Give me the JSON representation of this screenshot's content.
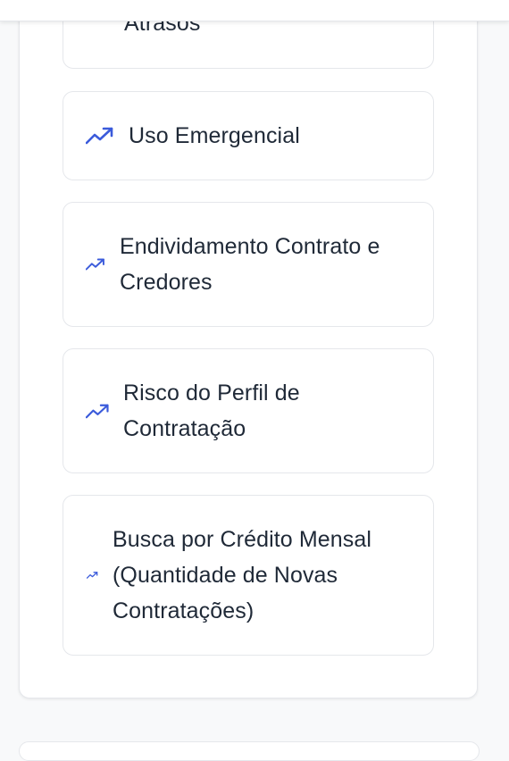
{
  "header": {},
  "indicator_list": {
    "items": [
      {
        "label": "Atrasos",
        "icon": "trending-up-icon"
      },
      {
        "label": "Uso Emergencial",
        "icon": "trending-up-icon"
      },
      {
        "label": "Endividamento Contrato e Credores",
        "icon": "trending-up-icon"
      },
      {
        "label": "Risco do Perfil de Contratação",
        "icon": "trending-up-icon"
      },
      {
        "label": "Busca por Crédito Mensal (Quantidade de Novas Contratações)",
        "icon": "trending-up-icon"
      }
    ]
  },
  "colors": {
    "icon_accent": "#3b5bdb",
    "text": "#1f2937",
    "border": "#e5e7eb",
    "background": "#f8f9fa",
    "card": "#ffffff"
  }
}
